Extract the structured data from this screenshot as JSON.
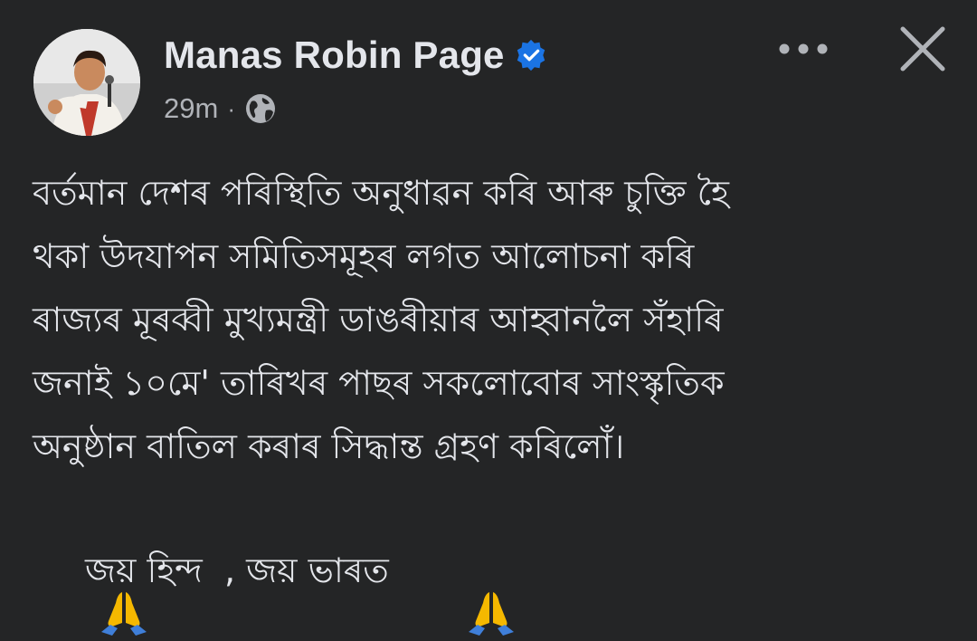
{
  "post": {
    "author_name": "Manas Robin Page",
    "timestamp": "29m",
    "meta_separator": "·",
    "audience_icon": "globe-icon",
    "verified_icon": "verified-badge-icon",
    "more_icon": "more-options-icon",
    "close_icon": "close-icon",
    "body_lines": [
      "বৰ্তমান দেশৰ পৰিস্থিতি অনুধাৱন কৰি আৰু চুক্তি হৈ",
      "থকা উদযাপন সমিতিসমূহৰ লগত আলোচনা কৰি",
      "ৰাজ্যৰ মূৰব্বী মুখ্যমন্ত্ৰী ডাঙৰীয়াৰ আহ্বানলৈ সঁহাৰি",
      "জনাই ১০মে' তাৰিখৰ পাছৰ সকলোবোৰ সাংস্কৃতিক",
      "অনুষ্ঠান বাতিল কৰাৰ সিদ্ধান্ত গ্ৰহণ কৰিলোঁ।"
    ],
    "closing_text": "জয় হিন্দ  , জয় ভাৰত ",
    "closing_icon": "folded-hands-icon"
  },
  "colors": {
    "background": "#242526",
    "primary_text": "#e4e6eb",
    "secondary_text": "#b0b3b8",
    "verified_blue": "#1b74e4"
  }
}
